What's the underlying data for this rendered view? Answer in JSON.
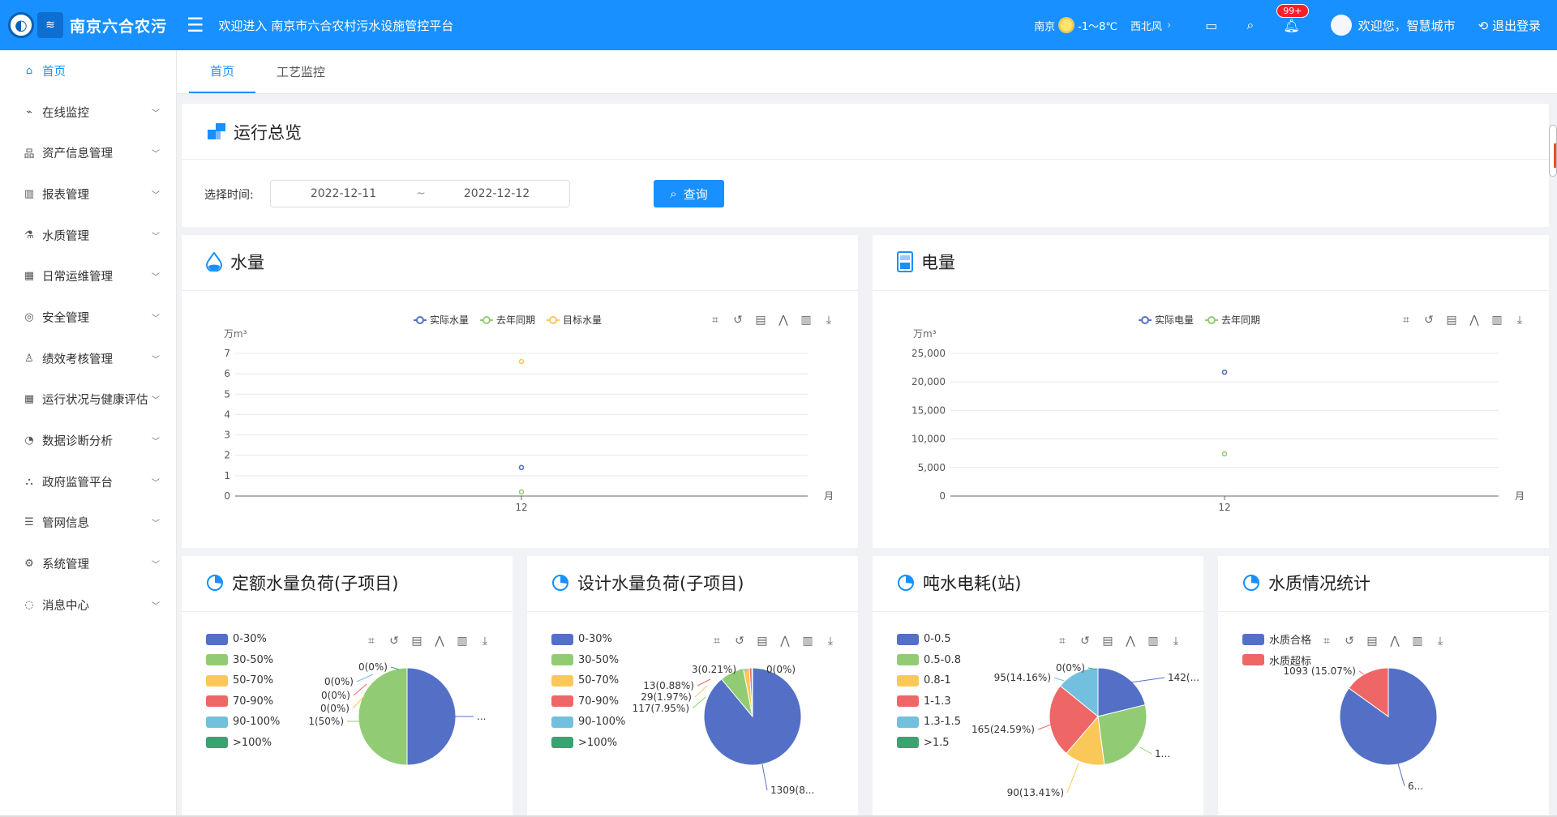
{
  "header": {
    "logo_text": "南京六合农污",
    "welcome": "欢迎进入 南京市六合农村污水设施管控平台",
    "weather_city": "南京",
    "weather_temp": "-1～8℃",
    "wind": "西北风",
    "badge": "99+",
    "hello": "欢迎您，智慧城市",
    "logout": "退出登录"
  },
  "sidebar": {
    "items": [
      {
        "label": "首页",
        "icon": "home-icon",
        "glyph": "⌂"
      },
      {
        "label": "在线监控",
        "icon": "line-chart-icon",
        "glyph": "⌁"
      },
      {
        "label": "资产信息管理",
        "icon": "org-icon",
        "glyph": "品"
      },
      {
        "label": "报表管理",
        "icon": "bar-chart-icon",
        "glyph": "▥"
      },
      {
        "label": "水质管理",
        "icon": "flask-icon",
        "glyph": "⚗"
      },
      {
        "label": "日常运维管理",
        "icon": "building-icon",
        "glyph": "▦"
      },
      {
        "label": "安全管理",
        "icon": "compass-icon",
        "glyph": "◎"
      },
      {
        "label": "绩效考核管理",
        "icon": "user-icon",
        "glyph": "♙"
      },
      {
        "label": "运行状况与健康评估",
        "icon": "grid-icon",
        "glyph": "▦"
      },
      {
        "label": "数据诊断分析",
        "icon": "pie-icon",
        "glyph": "◔"
      },
      {
        "label": "政府监管平台",
        "icon": "network-icon",
        "glyph": "⛬"
      },
      {
        "label": "管网信息",
        "icon": "list-icon",
        "glyph": "☰"
      },
      {
        "label": "系统管理",
        "icon": "gear-icon",
        "glyph": "⚙"
      },
      {
        "label": "消息中心",
        "icon": "chat-icon",
        "glyph": "◌"
      }
    ]
  },
  "tabs": [
    "首页",
    "工艺监控"
  ],
  "overview": {
    "title": "运行总览",
    "filter_label": "选择时间:",
    "start_date": "2022-12-11",
    "separator": "~",
    "end_date": "2022-12-12",
    "query": "查询"
  },
  "water_card": {
    "title": "水量"
  },
  "power_card": {
    "title": "电量"
  },
  "quota_card": {
    "title": "定额水量负荷(子项目)"
  },
  "design_card": {
    "title": "设计水量负荷(子项目)"
  },
  "ton_card": {
    "title": "吨水电耗(站)"
  },
  "quality_card": {
    "title": "水质情况统计"
  },
  "chart_data": [
    {
      "type": "scatter",
      "unit_label": "万m³",
      "x_axis_name": "月",
      "categories": [
        "12"
      ],
      "ylim": [
        0,
        7
      ],
      "yticks": [
        "0",
        "1",
        "2",
        "3",
        "4",
        "5",
        "6",
        "7"
      ],
      "series": [
        {
          "name": "实际水量",
          "color": "#5470c6",
          "values": [
            1.4
          ]
        },
        {
          "name": "去年同期",
          "color": "#91cc75",
          "values": [
            0.2
          ]
        },
        {
          "name": "目标水量",
          "color": "#fac858",
          "values": [
            6.6
          ]
        }
      ]
    },
    {
      "type": "scatter",
      "unit_label": "万m³",
      "x_axis_name": "月",
      "categories": [
        "12"
      ],
      "ylim": [
        0,
        25000
      ],
      "yticks": [
        "0",
        "5,000",
        "10,000",
        "15,000",
        "20,000",
        "25,000"
      ],
      "series": [
        {
          "name": "实际电量",
          "color": "#5470c6",
          "values": [
            21700
          ]
        },
        {
          "name": "去年同期",
          "color": "#91cc75",
          "values": [
            7400
          ]
        }
      ]
    },
    {
      "type": "pie",
      "legend": [
        {
          "name": "0-30%",
          "color": "#5470c6"
        },
        {
          "name": "30-50%",
          "color": "#91cc75"
        },
        {
          "name": "50-70%",
          "color": "#fac858"
        },
        {
          "name": "70-90%",
          "color": "#ee6666"
        },
        {
          "name": "90-100%",
          "color": "#73c0de"
        },
        {
          "name": ">100%",
          "color": "#3ba272"
        }
      ],
      "values": [
        1,
        1,
        0,
        0,
        0,
        0
      ],
      "labels": [
        "...",
        "1(50%)",
        "0(0%)",
        "0(0%)",
        "0(0%)",
        "0(0%)"
      ]
    },
    {
      "type": "pie",
      "legend": [
        {
          "name": "0-30%",
          "color": "#5470c6"
        },
        {
          "name": "30-50%",
          "color": "#91cc75"
        },
        {
          "name": "50-70%",
          "color": "#fac858"
        },
        {
          "name": "70-90%",
          "color": "#ee6666"
        },
        {
          "name": "90-100%",
          "color": "#73c0de"
        },
        {
          "name": ">100%",
          "color": "#3ba272"
        }
      ],
      "values": [
        1309,
        117,
        29,
        13,
        3,
        0
      ],
      "labels": [
        "1309(8...",
        "117(7.95%)",
        "29(1.97%)",
        "13(0.88%)",
        "3(0.21%)",
        "0(0%)"
      ]
    },
    {
      "type": "pie",
      "legend": [
        {
          "name": "0-0.5",
          "color": "#5470c6"
        },
        {
          "name": "0.5-0.8",
          "color": "#91cc75"
        },
        {
          "name": "0.8-1",
          "color": "#fac858"
        },
        {
          "name": "1-1.3",
          "color": "#ee6666"
        },
        {
          "name": "1.3-1.5",
          "color": "#73c0de"
        },
        {
          "name": ">1.5",
          "color": "#3ba272"
        }
      ],
      "values": [
        142,
        180,
        90,
        165,
        95,
        0
      ],
      "labels": [
        "142(...",
        "1...",
        "90(13.41%)",
        "165(24.59%)",
        "95(14.16%)",
        "0(0%)"
      ]
    },
    {
      "type": "pie",
      "legend": [
        {
          "name": "水质合格",
          "color": "#5470c6"
        },
        {
          "name": "水质超标",
          "color": "#ee6666"
        }
      ],
      "values": [
        6160,
        1093
      ],
      "labels": [
        "6...",
        "1093 (15.07%)"
      ]
    }
  ]
}
